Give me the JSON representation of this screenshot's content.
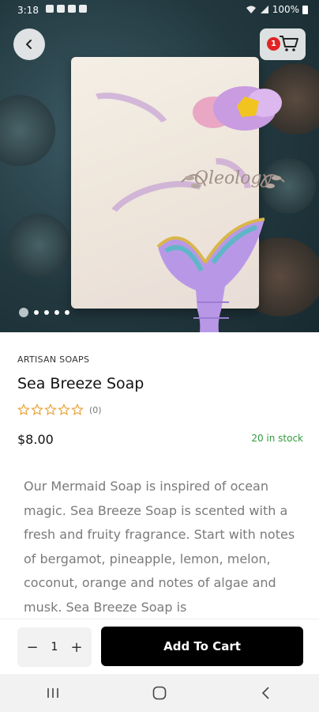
{
  "status_bar": {
    "time": "3:18",
    "battery": "100%"
  },
  "header": {
    "back_icon": "chevron-left-icon",
    "cart_icon": "cart-icon",
    "cart_badge": "1"
  },
  "gallery": {
    "image_count": 5,
    "active_index": 0
  },
  "product": {
    "category": "ARTISAN SOAPS",
    "title": "Sea Breeze Soap",
    "rating_stars": 5,
    "rating_value": 0,
    "review_count": "(0)",
    "price": "$8.00",
    "stock": "20 in stock",
    "description": "Our Mermaid Soap is inspired of ocean magic. Sea Breeze Soap is scented with a fresh and fruity fragrance. Start with notes of bergamot, pineapple, lemon, melon, coconut, orange and notes of algae and musk. Sea Breeze Soap is",
    "stamp_text": "Oleology"
  },
  "action_bar": {
    "qty_minus": "−",
    "qty_value": "1",
    "qty_plus": "+",
    "add_to_cart": "Add To Cart"
  },
  "colors": {
    "star": "#e8a33a",
    "stock": "#2f9c3a",
    "badge": "#e02424",
    "button": "#000000"
  }
}
